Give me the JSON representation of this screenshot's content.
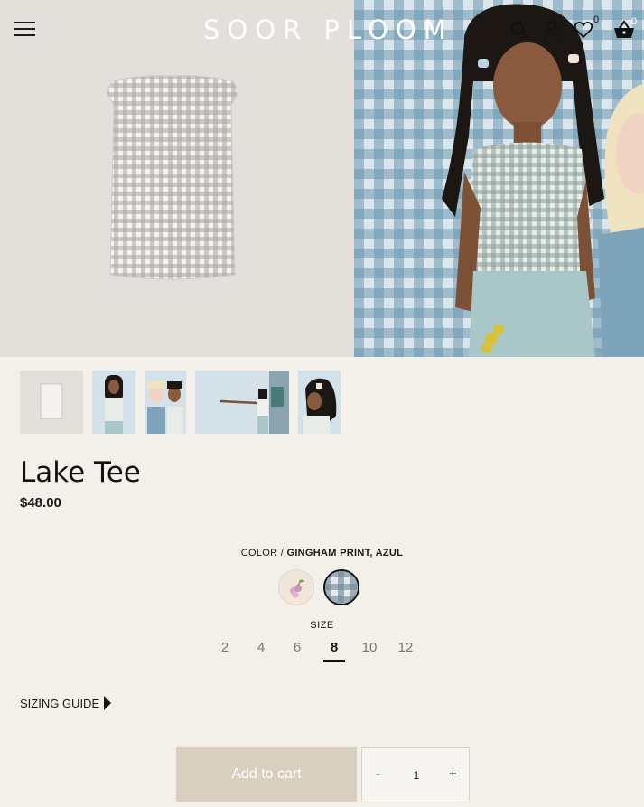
{
  "header": {
    "logo": "SOOR PLOOM",
    "wishlist_count": "0",
    "cart_count": "0"
  },
  "icons": [
    "menu-icon",
    "search-icon",
    "account-icon",
    "heart-icon",
    "basket-icon",
    "caret-right-icon"
  ],
  "product": {
    "title": "Lake Tee",
    "price": "$48.00",
    "color_label": "COLOR / ",
    "color_value": "GINGHAM PRINT, AZUL",
    "size_label": "SIZE",
    "sizes": [
      "2",
      "4",
      "6",
      "8",
      "10",
      "12"
    ],
    "selected_size": "8",
    "sizing_guide": "SIZING GUIDE",
    "add_to_cart": "Add to cart",
    "qty_minus": "-",
    "qty_value": "1",
    "qty_plus": "+"
  },
  "colors": {
    "background": "#f3f0ea",
    "add_button": "#d9cfbf",
    "gingham_blue": "#6c98b2"
  }
}
